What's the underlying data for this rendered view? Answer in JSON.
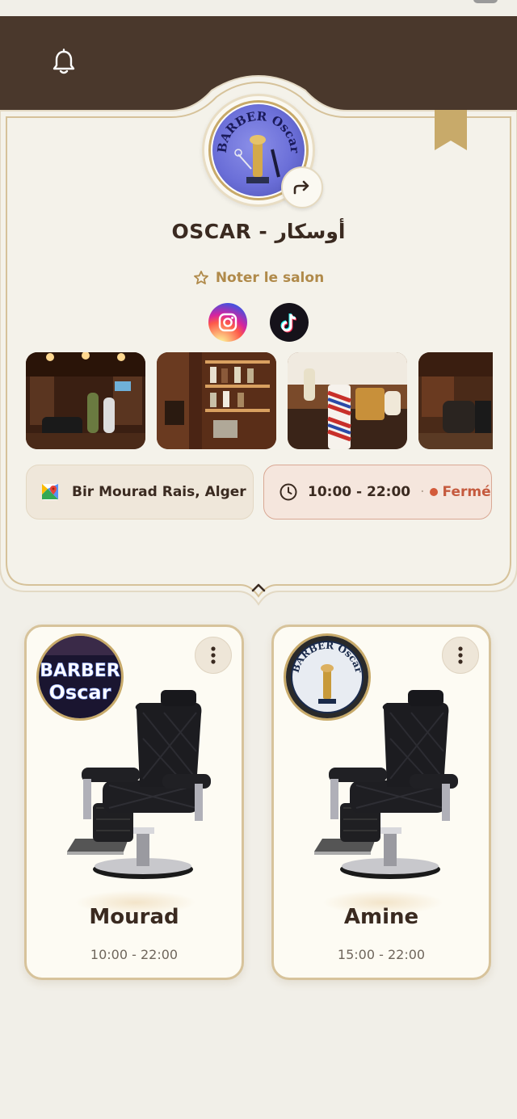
{
  "salon": {
    "name": "OSCAR - أوسكار",
    "rate_label": "Noter le salon",
    "location": "Bir Mourad Rais, Alger",
    "hours": "10:00 - 22:00",
    "hours_separator": "·",
    "status": "Fermé"
  },
  "logo": {
    "line1": "BARBER Oscar"
  },
  "socials": [
    {
      "name": "Instagram",
      "icon": "instagram-icon"
    },
    {
      "name": "TikTok",
      "icon": "tiktok-icon"
    }
  ],
  "gallery_count": 4,
  "barbers": [
    {
      "name": "Mourad",
      "hours": "10:00 - 22:00",
      "badge_line1": "BARBER",
      "badge_line2": "Oscar"
    },
    {
      "name": "Amine",
      "hours": "15:00 - 22:00",
      "badge_line1": "BARBER Oscar"
    }
  ],
  "colors": {
    "header_brown": "#4a382c",
    "background": "#f1efe8",
    "gold": "#c8aa6a",
    "accent_text": "#b08a4a",
    "closed_red": "#c55a3e"
  }
}
